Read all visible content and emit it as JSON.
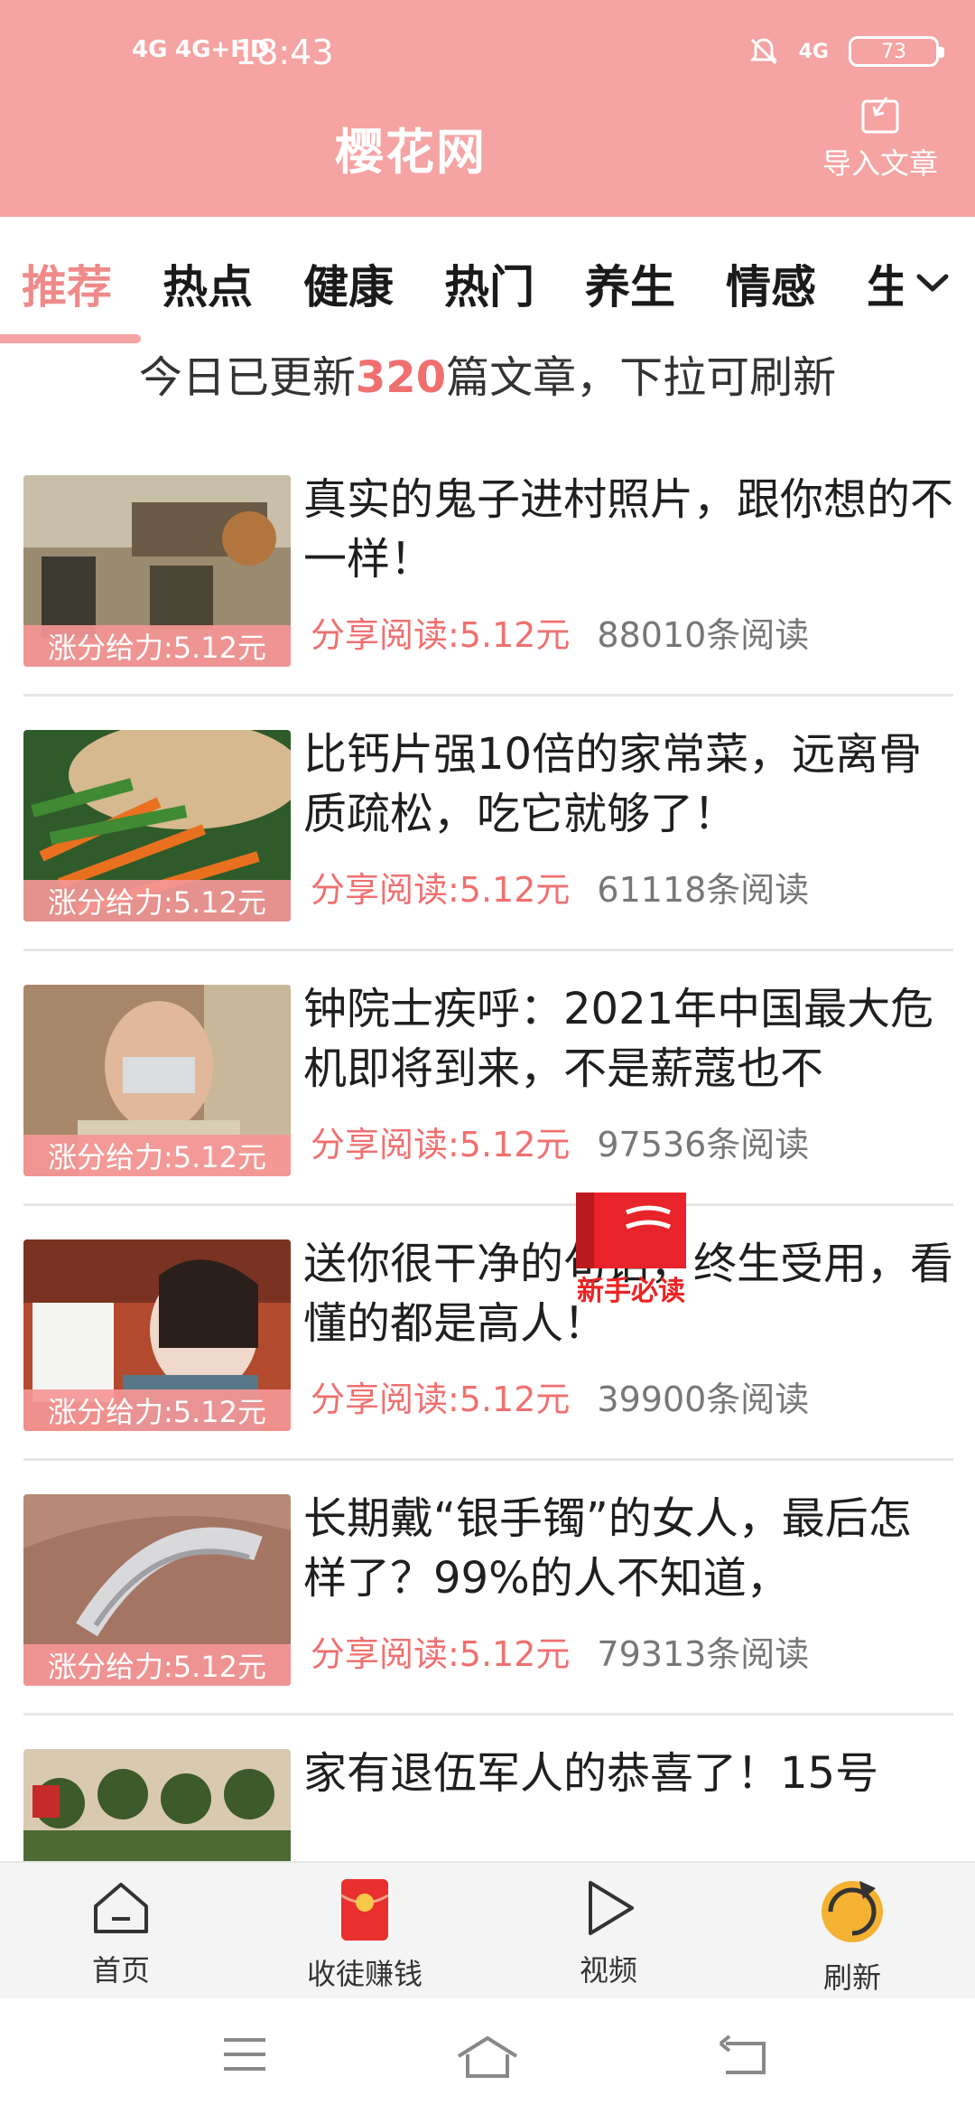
{
  "status_bar": {
    "signal_1": "4G",
    "signal_2": "4G+HD",
    "time": "18:43",
    "net": "4G",
    "battery": "73"
  },
  "header": {
    "title": "樱花网",
    "import_label": "导入文章"
  },
  "tabs": [
    "推荐",
    "热点",
    "健康",
    "热门",
    "养生",
    "情感",
    "生"
  ],
  "update_notice": {
    "prefix": "今日已更新",
    "count": "320",
    "suffix": "篇文章，下拉可刷新"
  },
  "articles": [
    {
      "title": "真实的鬼子进村照片，跟你想的不一样！",
      "tag": "涨分给力:5.12元",
      "share": "分享阅读:5.12元",
      "reads": "88010条阅读"
    },
    {
      "title": "比钙片强10倍的家常菜，远离骨质疏松，吃它就够了！",
      "tag": "涨分给力:5.12元",
      "share": "分享阅读:5.12元",
      "reads": "61118条阅读"
    },
    {
      "title": "钟院士疾呼：2021年中国最大危机即将到来，不是薪蔻也不",
      "tag": "涨分给力:5.12元",
      "share": "分享阅读:5.12元",
      "reads": "97536条阅读"
    },
    {
      "title": "送你很干净的句话，终生受用，看懂的都是高人！",
      "tag": "涨分给力:5.12元",
      "share": "分享阅读:5.12元",
      "reads": "39900条阅读"
    },
    {
      "title": "长期戴“银手镯”的女人，最后怎样了？99%的人不知道，",
      "tag": "涨分给力:5.12元",
      "share": "分享阅读:5.12元",
      "reads": "79313条阅读"
    },
    {
      "title": "家有退伍军人的恭喜了！15号",
      "tag": "",
      "share": "",
      "reads": ""
    }
  ],
  "guide_badge": "新手必读",
  "bottom_nav": {
    "home": "首页",
    "recruit": "收徒赚钱",
    "video": "视频",
    "refresh": "刷新"
  },
  "colors": {
    "brand": "#f5a3a3",
    "accent_text": "#f07070"
  }
}
